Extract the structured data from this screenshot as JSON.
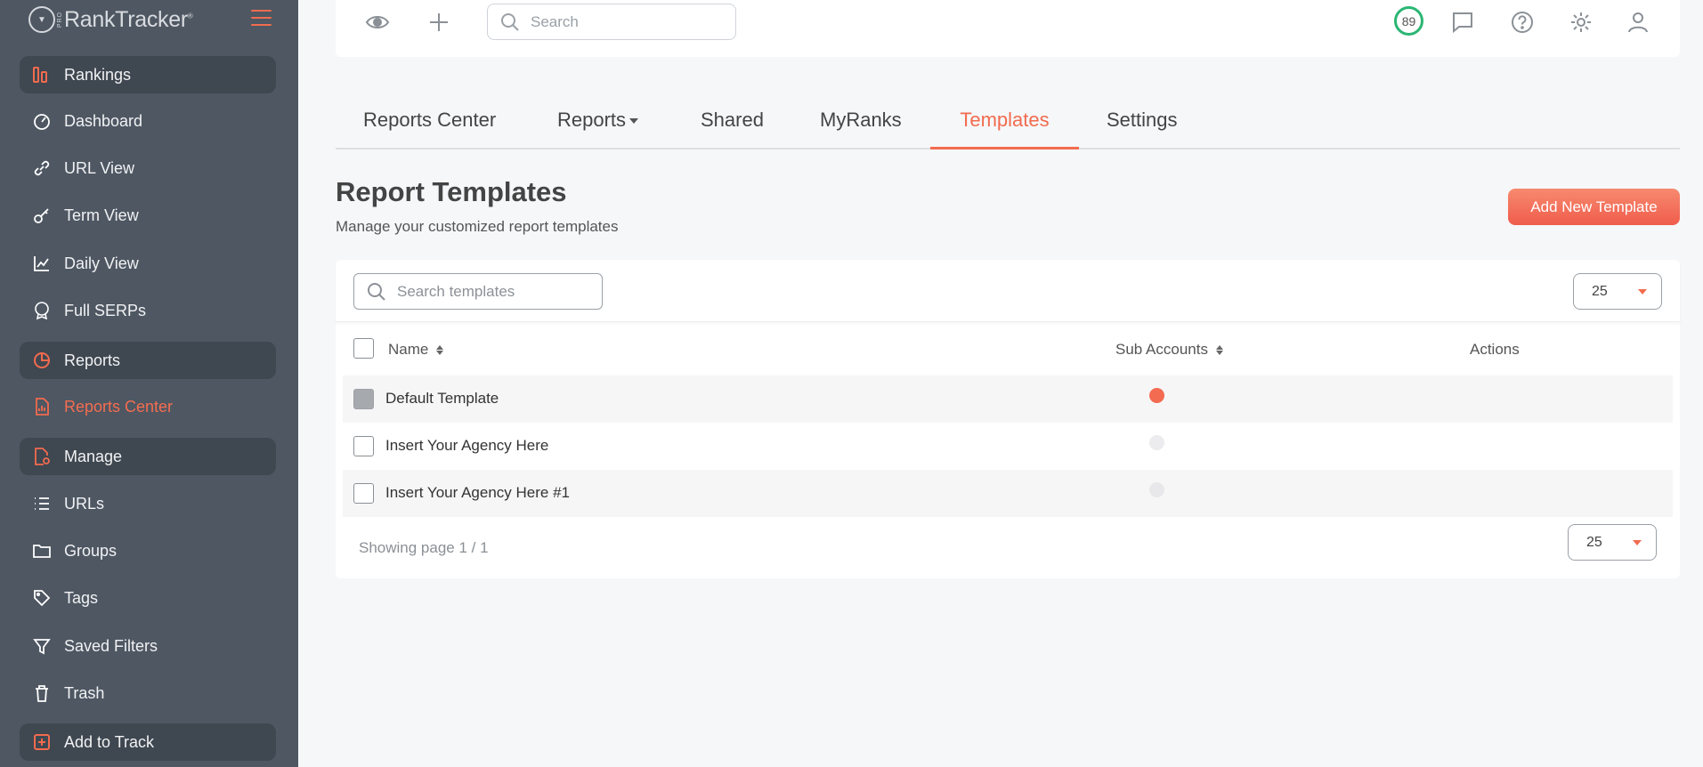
{
  "brand": {
    "name": "RankTracker",
    "pro": "PRO",
    "reg": "®"
  },
  "sidebar": {
    "items": [
      {
        "label": "Rankings",
        "icon": "rankings-icon",
        "section": true
      },
      {
        "label": "Dashboard",
        "icon": "gauge-icon"
      },
      {
        "label": "URL View",
        "icon": "link-icon"
      },
      {
        "label": "Term View",
        "icon": "key-icon"
      },
      {
        "label": "Daily View",
        "icon": "line-chart-icon"
      },
      {
        "label": "Full SERPs",
        "icon": "serp-badge-icon"
      },
      {
        "label": "Reports",
        "icon": "pie-chart-icon",
        "section": true
      },
      {
        "label": "Reports Center",
        "icon": "report-file-icon",
        "active": true
      },
      {
        "label": "Manage",
        "icon": "file-gear-icon",
        "section": true
      },
      {
        "label": "URLs",
        "icon": "list-icon"
      },
      {
        "label": "Groups",
        "icon": "folder-icon"
      },
      {
        "label": "Tags",
        "icon": "tag-icon"
      },
      {
        "label": "Saved Filters",
        "icon": "filter-icon"
      },
      {
        "label": "Trash",
        "icon": "trash-icon"
      },
      {
        "label": "Add to Track",
        "icon": "plus-square-icon",
        "section": true
      }
    ]
  },
  "topbar": {
    "search_placeholder": "Search",
    "score": "89"
  },
  "tabs": [
    {
      "label": "Reports Center"
    },
    {
      "label": "Reports"
    },
    {
      "label": "Shared"
    },
    {
      "label": "MyRanks"
    },
    {
      "label": "Templates",
      "active": true
    },
    {
      "label": "Settings"
    }
  ],
  "page": {
    "title": "Report Templates",
    "subtitle": "Manage your customized report templates",
    "add_button": "Add New Template"
  },
  "table": {
    "search_placeholder": "Search templates",
    "per_page": "25",
    "columns": {
      "name": "Name",
      "sub_accounts": "Sub Accounts",
      "actions": "Actions"
    },
    "rows": [
      {
        "name": "Default Template",
        "sub_account_active": true
      },
      {
        "name": "Insert Your Agency Here",
        "sub_account_active": false
      },
      {
        "name": "Insert Your Agency Here #1",
        "sub_account_active": false
      }
    ],
    "pager_text": "Showing page 1 / 1",
    "per_page_bottom": "25"
  },
  "colors": {
    "accent": "#f26b4f",
    "sidebar_bg": "#4e5762",
    "score_ring": "#2bb673"
  }
}
